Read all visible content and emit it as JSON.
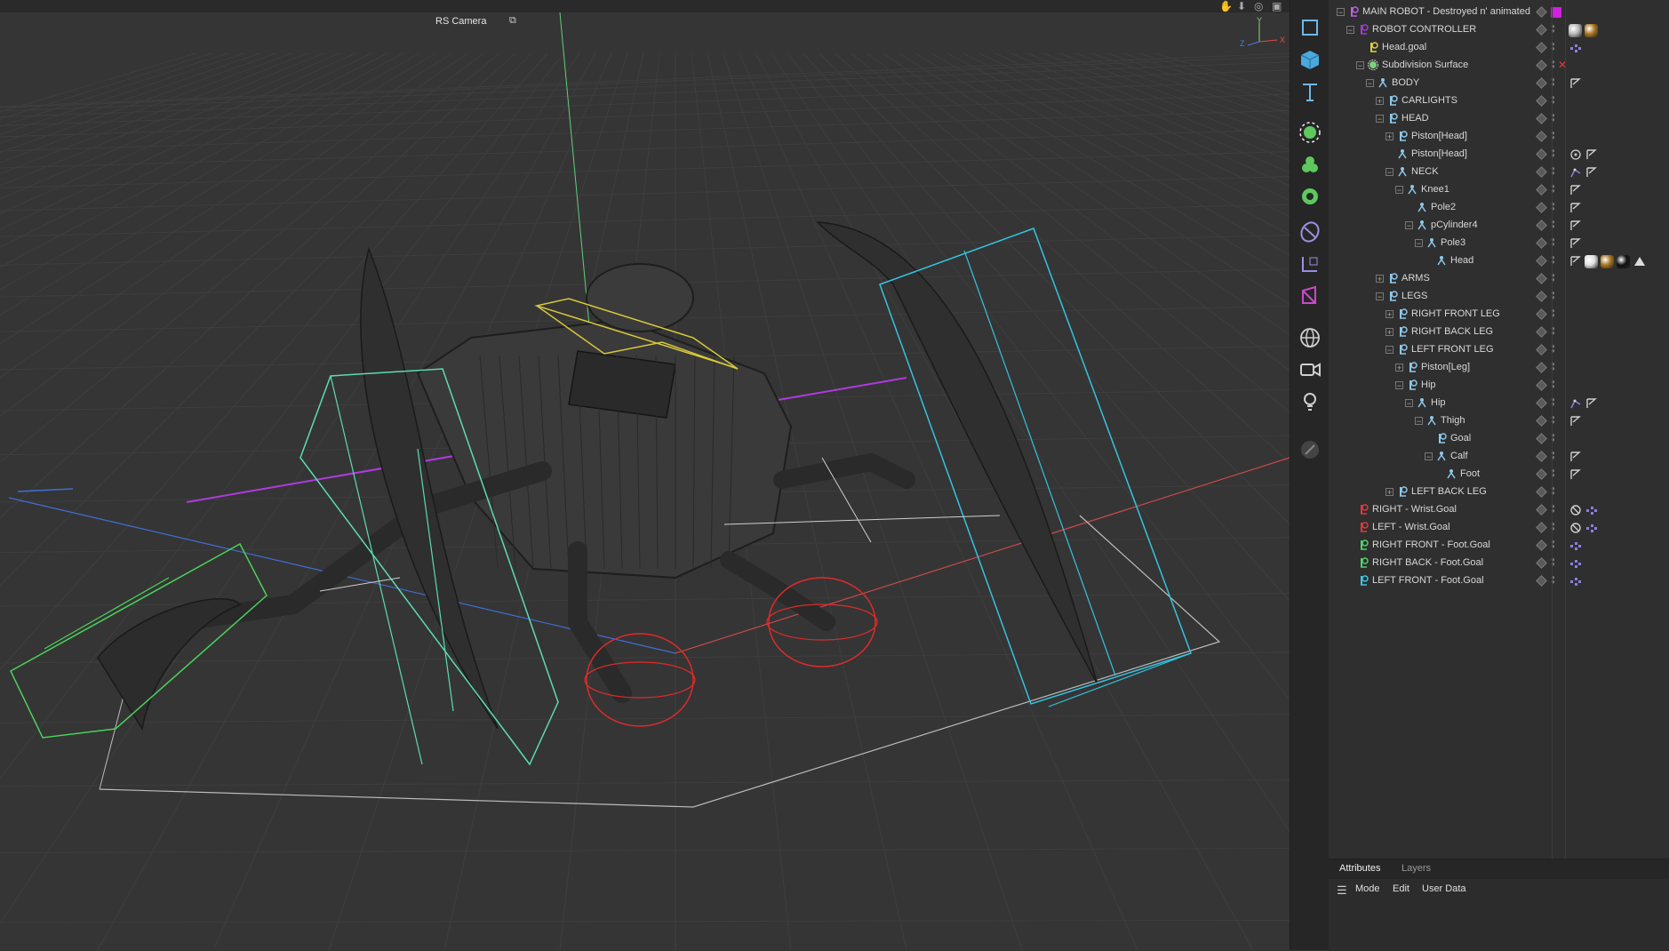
{
  "viewport": {
    "camera_label": "RS Camera",
    "axis_labels": {
      "x": "X",
      "y": "Y",
      "z": "Z"
    }
  },
  "toolbar": {
    "tools": [
      "select-rect-icon",
      "cube-icon",
      "text-tool-icon",
      "generator-icon",
      "mograph-icon",
      "deformer-icon",
      "spline-pen-icon",
      "scene-icon",
      "character-icon",
      "mograph-effector-icon",
      "environment-icon",
      "camera-icon",
      "light-icon",
      "edit-icon"
    ]
  },
  "object_manager": {
    "rows": [
      {
        "name": "MAIN ROBOT - Destroyed n' animated",
        "depth": 0,
        "expanded": true,
        "icon": "null",
        "color": "#c060e0",
        "tags": [
          "purple-swatch"
        ]
      },
      {
        "name": "ROBOT CONTROLLER",
        "depth": 1,
        "expanded": true,
        "icon": "null",
        "color": "#9b3fd0",
        "tags": [
          "material-grey",
          "material-gold"
        ]
      },
      {
        "name": "Head.goal",
        "depth": 2,
        "expanded": null,
        "icon": "null",
        "color": "#e0d040",
        "tags": [
          "ik-tag"
        ]
      },
      {
        "name": "Subdivision Surface",
        "depth": 2,
        "expanded": true,
        "icon": "subdiv",
        "color": "#7cd27c",
        "tags": [],
        "status": "x"
      },
      {
        "name": "BODY",
        "depth": 3,
        "expanded": true,
        "icon": "joint",
        "color": "#8ec8ea",
        "tags": [
          "flag"
        ]
      },
      {
        "name": "CARLIGHTS",
        "depth": 4,
        "expanded": false,
        "icon": "null",
        "color": "#8ec8ea",
        "tags": []
      },
      {
        "name": "HEAD",
        "depth": 4,
        "expanded": true,
        "icon": "null",
        "color": "#8ec8ea",
        "tags": []
      },
      {
        "name": "Piston[Head]",
        "depth": 5,
        "expanded": false,
        "icon": "null",
        "color": "#8ec8ea",
        "tags": []
      },
      {
        "name": "Piston[Head]",
        "depth": 5,
        "expanded": null,
        "icon": "joint",
        "color": "#8ec8ea",
        "tags": [
          "target",
          "flag"
        ]
      },
      {
        "name": "NECK",
        "depth": 5,
        "expanded": true,
        "icon": "joint",
        "color": "#8ec8ea",
        "tags": [
          "ik-chain",
          "flag"
        ]
      },
      {
        "name": "Knee1",
        "depth": 6,
        "expanded": true,
        "icon": "joint",
        "color": "#8ec8ea",
        "tags": [
          "flag"
        ]
      },
      {
        "name": "Pole2",
        "depth": 7,
        "expanded": null,
        "icon": "joint",
        "color": "#8ec8ea",
        "tags": [
          "flag"
        ]
      },
      {
        "name": "pCylinder4",
        "depth": 7,
        "expanded": true,
        "icon": "joint",
        "color": "#8ec8ea",
        "tags": [
          "flag"
        ]
      },
      {
        "name": "Pole3",
        "depth": 8,
        "expanded": true,
        "icon": "joint",
        "color": "#8ec8ea",
        "tags": [
          "flag"
        ]
      },
      {
        "name": "Head",
        "depth": 9,
        "expanded": null,
        "icon": "joint",
        "color": "#8ec8ea",
        "tags": [
          "flag",
          "material-white",
          "material-gold",
          "material-black",
          "phong"
        ]
      },
      {
        "name": "ARMS",
        "depth": 4,
        "expanded": false,
        "icon": "null",
        "color": "#8ec8ea",
        "tags": []
      },
      {
        "name": "LEGS",
        "depth": 4,
        "expanded": true,
        "icon": "null",
        "color": "#8ec8ea",
        "tags": []
      },
      {
        "name": "RIGHT FRONT LEG",
        "depth": 5,
        "expanded": false,
        "icon": "null",
        "color": "#8ec8ea",
        "tags": []
      },
      {
        "name": "RIGHT BACK LEG",
        "depth": 5,
        "expanded": false,
        "icon": "null",
        "color": "#8ec8ea",
        "tags": []
      },
      {
        "name": "LEFT FRONT LEG",
        "depth": 5,
        "expanded": true,
        "icon": "null",
        "color": "#8ec8ea",
        "tags": []
      },
      {
        "name": "Piston[Leg]",
        "depth": 6,
        "expanded": false,
        "icon": "null",
        "color": "#8ec8ea",
        "tags": []
      },
      {
        "name": "Hip",
        "depth": 6,
        "expanded": true,
        "icon": "null",
        "color": "#8ec8ea",
        "tags": []
      },
      {
        "name": "Hip",
        "depth": 7,
        "expanded": true,
        "icon": "joint",
        "color": "#8ec8ea",
        "tags": [
          "ik-chain",
          "flag"
        ]
      },
      {
        "name": "Thigh",
        "depth": 8,
        "expanded": true,
        "icon": "joint",
        "color": "#8ec8ea",
        "tags": [
          "flag"
        ]
      },
      {
        "name": "Goal",
        "depth": 9,
        "expanded": null,
        "icon": "null",
        "color": "#8ec8ea",
        "tags": []
      },
      {
        "name": "Calf",
        "depth": 9,
        "expanded": true,
        "icon": "joint",
        "color": "#8ec8ea",
        "tags": [
          "flag"
        ]
      },
      {
        "name": "Foot",
        "depth": 10,
        "expanded": null,
        "icon": "joint",
        "color": "#8ec8ea",
        "tags": [
          "flag"
        ]
      },
      {
        "name": "LEFT BACK LEG",
        "depth": 5,
        "expanded": false,
        "icon": "null",
        "color": "#8ec8ea",
        "tags": []
      },
      {
        "name": "RIGHT - Wrist.Goal",
        "depth": 1,
        "expanded": null,
        "icon": "null",
        "color": "#e03a3a",
        "tags": [
          "forbidden",
          "ik-tag"
        ]
      },
      {
        "name": "LEFT - Wrist.Goal",
        "depth": 1,
        "expanded": null,
        "icon": "null",
        "color": "#e03a3a",
        "tags": [
          "forbidden",
          "ik-tag"
        ]
      },
      {
        "name": "RIGHT FRONT - Foot.Goal",
        "depth": 1,
        "expanded": null,
        "icon": "null",
        "color": "#4fd36a",
        "tags": [
          "ik-tag"
        ]
      },
      {
        "name": "RIGHT BACK - Foot.Goal",
        "depth": 1,
        "expanded": null,
        "icon": "null",
        "color": "#4fd36a",
        "tags": [
          "ik-tag"
        ]
      },
      {
        "name": "LEFT FRONT - Foot.Goal",
        "depth": 1,
        "expanded": null,
        "icon": "null",
        "color": "#3fc6e0",
        "tags": [
          "ik-tag"
        ]
      }
    ]
  },
  "attributes": {
    "tabs": [
      "Attributes",
      "Layers"
    ],
    "active_tab": "Attributes",
    "menu": [
      "Mode",
      "Edit",
      "User Data"
    ]
  }
}
